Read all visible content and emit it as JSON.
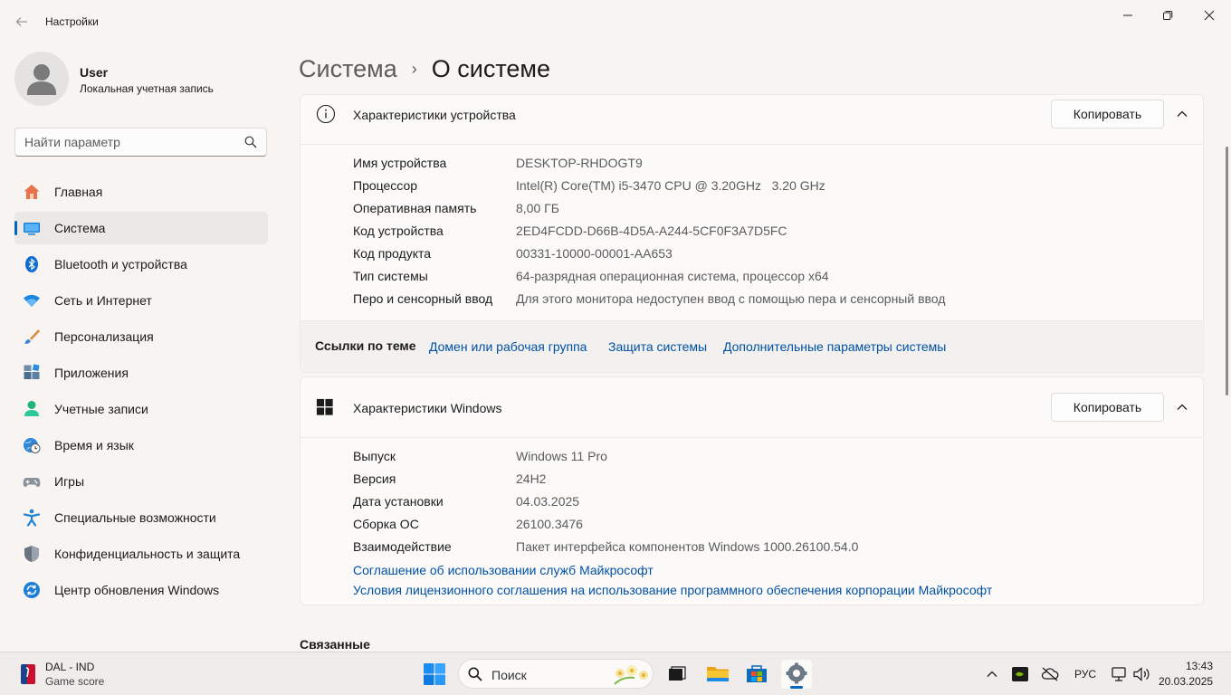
{
  "window": {
    "title": "Настройки"
  },
  "user": {
    "name": "User",
    "account_type": "Локальная учетная запись"
  },
  "search": {
    "placeholder": "Найти параметр"
  },
  "nav": {
    "items": [
      {
        "label": "Главная"
      },
      {
        "label": "Система"
      },
      {
        "label": "Bluetooth и устройства"
      },
      {
        "label": "Сеть и Интернет"
      },
      {
        "label": "Персонализация"
      },
      {
        "label": "Приложения"
      },
      {
        "label": "Учетные записи"
      },
      {
        "label": "Время и язык"
      },
      {
        "label": "Игры"
      },
      {
        "label": "Специальные возможности"
      },
      {
        "label": "Конфиденциальность и защита"
      },
      {
        "label": "Центр обновления Windows"
      }
    ],
    "active_index": 1
  },
  "breadcrumb": {
    "parent": "Система",
    "separator": "›",
    "current": "О системе"
  },
  "device_card": {
    "title": "Характеристики устройства",
    "copy_label": "Копировать",
    "rows": [
      {
        "label": "Имя устройства",
        "value": "DESKTOP-RHDOGT9"
      },
      {
        "label": "Процессор",
        "value": "Intel(R) Core(TM) i5-3470 CPU @ 3.20GHz   3.20 GHz"
      },
      {
        "label": "Оперативная память",
        "value": "8,00 ГБ"
      },
      {
        "label": "Код устройства",
        "value": "2ED4FCDD-D66B-4D5A-A244-5CF0F3A7D5FC"
      },
      {
        "label": "Код продукта",
        "value": "00331-10000-00001-AA653"
      },
      {
        "label": "Тип системы",
        "value": "64-разрядная операционная система, процессор x64"
      },
      {
        "label": "Перо и сенсорный ввод",
        "value": "Для этого монитора недоступен ввод с помощью пера и сенсорный ввод"
      }
    ],
    "related_links": {
      "label": "Ссылки по теме",
      "links": [
        "Домен или рабочая группа",
        "Защита системы",
        "Дополнительные параметры системы"
      ]
    }
  },
  "windows_card": {
    "title": "Характеристики Windows",
    "copy_label": "Копировать",
    "rows": [
      {
        "label": "Выпуск",
        "value": "Windows 11 Pro"
      },
      {
        "label": "Версия",
        "value": "24H2"
      },
      {
        "label": "Дата установки",
        "value": "04.03.2025"
      },
      {
        "label": "Сборка ОС",
        "value": "26100.3476"
      },
      {
        "label": "Взаимодействие",
        "value": "Пакет интерфейса компонентов Windows 1000.26100.54.0"
      }
    ],
    "links": [
      "Соглашение об использовании служб Майкрософт",
      "Условия лицензионного соглашения на использование программного обеспечения корпорации Майкрософт"
    ]
  },
  "related_section": {
    "title": "Связанные"
  },
  "taskbar": {
    "widget": {
      "title": "DAL - IND",
      "subtitle": "Game score"
    },
    "search_label": "Поиск",
    "language": "РУС",
    "time": "13:43",
    "date": "20.03.2025"
  },
  "colors": {
    "accent": "#0067c0",
    "link": "#0050a4",
    "window_bg": "#f7f4f2",
    "card_bg": "#fbfaf9"
  }
}
